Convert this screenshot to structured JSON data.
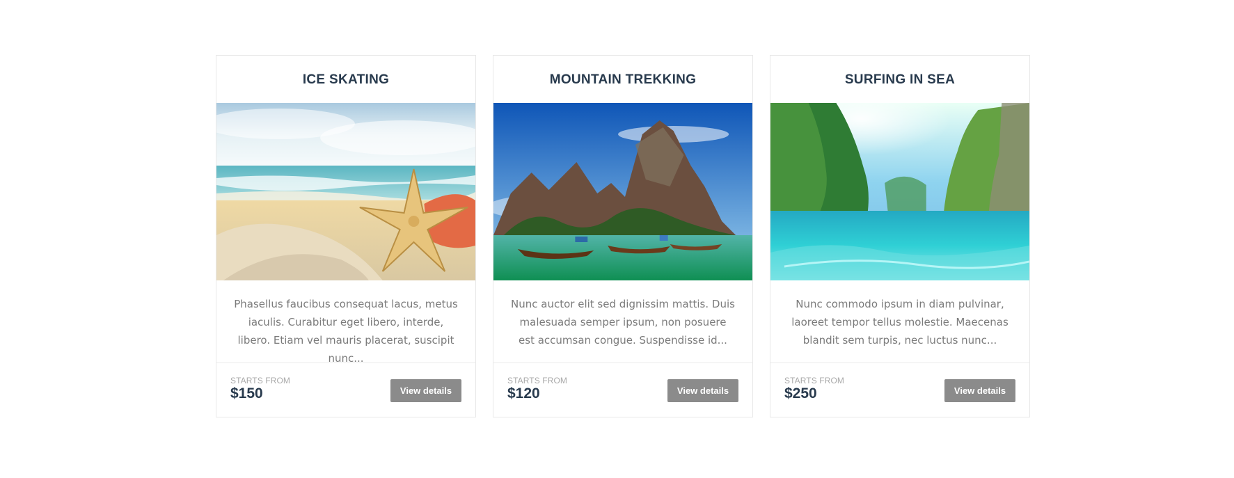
{
  "cards": [
    {
      "title": "ICE SKATING",
      "image_alt": "beach with starfish and coral",
      "description": "Phasellus faucibus consequat lacus, metus iaculis. Curabitur eget libero, interde, libero. Etiam vel mauris placerat, suscipit nunc...",
      "starts_from_label": "STARTS FROM",
      "price": "$150",
      "button_label": "View details"
    },
    {
      "title": "MOUNTAIN TREKKING",
      "image_alt": "tropical limestone cliffs with long-tail boats",
      "description": "Nunc auctor elit sed dignissim mattis. Duis malesuada semper ipsum, non posuere est accumsan congue. Suspendisse id...",
      "starts_from_label": "STARTS FROM",
      "price": "$120",
      "button_label": "View details"
    },
    {
      "title": "SURFING IN SEA",
      "image_alt": "turquoise lagoon between green cliffs",
      "description": "Nunc commodo ipsum in diam pulvinar, laoreet tempor tellus molestie. Maecenas blandit sem turpis, nec luctus nunc...",
      "starts_from_label": "STARTS FROM",
      "price": "$250",
      "button_label": "View details"
    }
  ],
  "colors": {
    "title": "#283a4d",
    "description": "#7b7b7b",
    "muted_label": "#a9a9a9",
    "button_background": "#8b8b8b",
    "button_text": "#ffffff",
    "card_border": "#e8e8e8"
  }
}
